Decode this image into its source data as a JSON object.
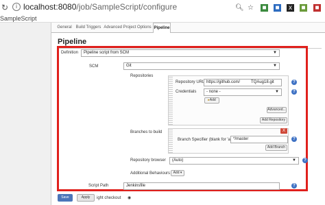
{
  "browser": {
    "url_host": "localhost:8080",
    "url_path": "/job/SampleScript/configure",
    "bookmark": "SampleScript"
  },
  "tabs": [
    "General",
    "Build Triggers",
    "Advanced Project Options",
    "Pipeline"
  ],
  "section_title": "Pipeline",
  "definition": {
    "label": "Definition",
    "value": "Pipeline script from SCM"
  },
  "scm": {
    "label": "SCM",
    "value": "Git"
  },
  "repositories": {
    "label": "Repositories",
    "url_label": "Repository URL",
    "url_value": "https://github.com/",
    "url_value_tail": "TQAug18.git",
    "credentials_label": "Credentials",
    "credentials_value": "- none -",
    "add_label": "Add",
    "advanced_label": "Advanced...",
    "add_repository_label": "Add Repository"
  },
  "branches": {
    "label": "Branches to build",
    "specifier_label": "Branch Specifier (blank for 'any')",
    "specifier_value": "*/master",
    "add_branch_label": "Add Branch",
    "remove_label": "X"
  },
  "repo_browser": {
    "label": "Repository browser",
    "value": "(Auto)"
  },
  "additional_behaviours": {
    "label": "Additional Behaviours",
    "add_label": "Add"
  },
  "script_path": {
    "label": "Script Path",
    "value": "Jenkinsfile"
  },
  "footer": {
    "save_label": "Save",
    "apply_label": "Apply",
    "light_checkout_label": "ight checkout"
  },
  "colors": {
    "highlight": "#e0201c",
    "help": "#3f72c4",
    "save": "#4b75b9"
  }
}
